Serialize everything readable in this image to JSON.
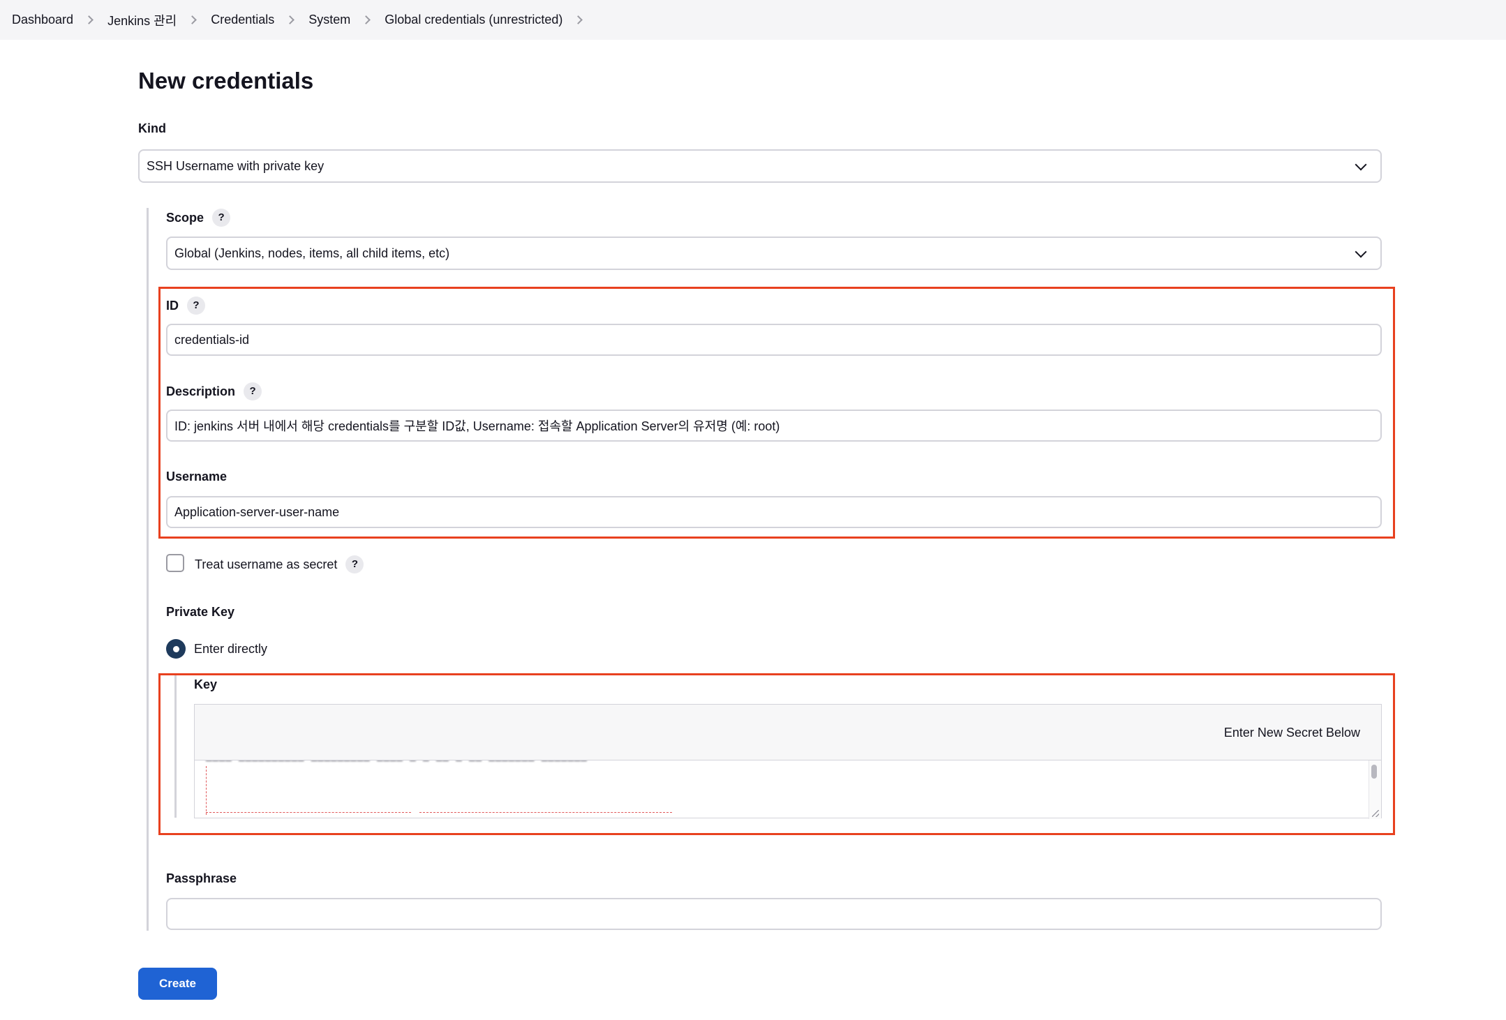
{
  "breadcrumbs": [
    "Dashboard",
    "Jenkins 관리",
    "Credentials",
    "System",
    "Global credentials (unrestricted)"
  ],
  "page_title": "New credentials",
  "kind": {
    "label": "Kind",
    "value": "SSH Username with private key"
  },
  "scope": {
    "label": "Scope",
    "help": "?",
    "value": "Global (Jenkins, nodes, items, all child items, etc)"
  },
  "id_field": {
    "label": "ID",
    "help": "?",
    "value": "credentials-id"
  },
  "description": {
    "label": "Description",
    "help": "?",
    "value": "ID: jenkins 서버 내에서 해당 credentials를 구분할 ID값, Username: 접속할 Application Server의 유저명 (예: root)"
  },
  "username": {
    "label": "Username",
    "value": "Application-server-user-name"
  },
  "treat_secret": {
    "label": "Treat username as secret",
    "help": "?",
    "checked": false
  },
  "private_key": {
    "label": "Private Key",
    "option_label": "Enter directly",
    "key_label": "Key",
    "secret_header": "Enter New Secret Below"
  },
  "passphrase": {
    "label": "Passphrase",
    "value": ""
  },
  "create_button": "Create",
  "colors": {
    "highlight": "#e8411f",
    "primary": "#1f63d4",
    "radio": "#1e3a5c"
  }
}
